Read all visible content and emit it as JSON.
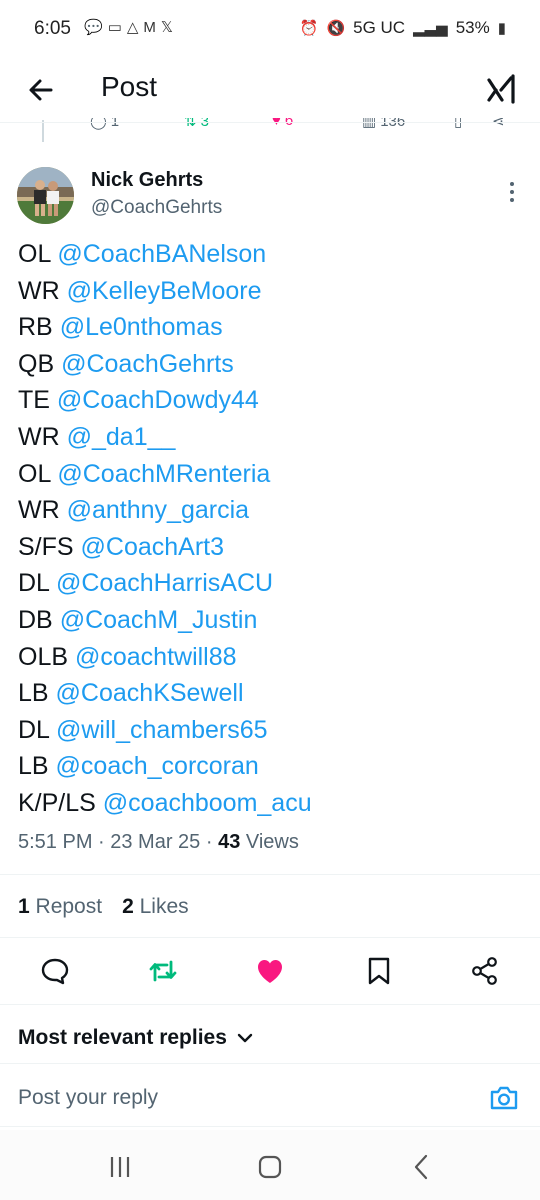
{
  "status": {
    "time": "6:05",
    "left_icons": [
      "chat-bubble-icon",
      "message-icon",
      "drive-icon",
      "gmail-icon",
      "x-icon"
    ],
    "network": "5G UC",
    "battery": "53%"
  },
  "header": {
    "title": "Post"
  },
  "prev_post_actions": {
    "replies": "1",
    "reposts": "3",
    "likes": "6",
    "views": "136"
  },
  "author": {
    "name": "Nick Gehrts",
    "handle": "@CoachGehrts"
  },
  "roster": [
    {
      "pos": "OL",
      "handle": "@CoachBANelson"
    },
    {
      "pos": "WR",
      "handle": "@KelleyBeMoore"
    },
    {
      "pos": "RB",
      "handle": "@Le0nthomas"
    },
    {
      "pos": "QB",
      "handle": "@CoachGehrts"
    },
    {
      "pos": "TE",
      "handle": "@CoachDowdy44"
    },
    {
      "pos": "WR",
      "handle": "@_da1__"
    },
    {
      "pos": "OL",
      "handle": "@CoachMRenteria"
    },
    {
      "pos": "WR",
      "handle": "@anthny_garcia"
    },
    {
      "pos": "S/FS",
      "handle": "@CoachArt3"
    },
    {
      "pos": "DL",
      "handle": "@CoachHarrisACU"
    },
    {
      "pos": "DB",
      "handle": "@CoachM_Justin"
    },
    {
      "pos": "OLB",
      "handle": "@coachtwill88"
    },
    {
      "pos": "LB",
      "handle": "@CoachKSewell"
    },
    {
      "pos": "DL",
      "handle": "@will_chambers65"
    },
    {
      "pos": "LB",
      "handle": "@coach_corcoran"
    },
    {
      "pos": "K/P/LS",
      "handle": "@coachboom_acu"
    }
  ],
  "meta": {
    "time_date": "5:51 PM · 23 Mar 25 · ",
    "views_count": "43",
    "views_label": " Views"
  },
  "stats": {
    "reposts_count": "1",
    "reposts_label": "Repost",
    "likes_count": "2",
    "likes_label": "Likes"
  },
  "colors": {
    "link": "#1d9bf0",
    "repost": "#00ba7c",
    "like": "#f91880",
    "muted": "#536471",
    "text": "#0f1419"
  },
  "replies": {
    "sort_label": "Most relevant replies",
    "placeholder": "Post your reply"
  }
}
